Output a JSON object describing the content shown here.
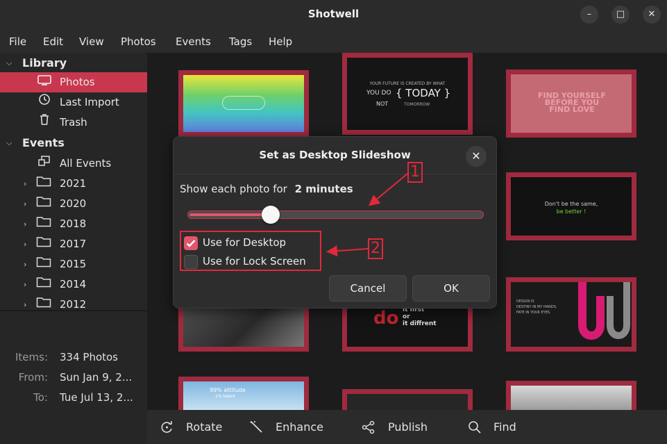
{
  "window": {
    "title": "Shotwell"
  },
  "window_controls": {
    "minimize": "–",
    "maximize": "□",
    "close": "✕"
  },
  "menu": [
    "File",
    "Edit",
    "View",
    "Photos",
    "Events",
    "Tags",
    "Help"
  ],
  "sidebar": {
    "library_header": "Library",
    "library_items": [
      {
        "label": "Photos",
        "icon": "monitor-icon",
        "selected": true
      },
      {
        "label": "Last Import",
        "icon": "history-icon"
      },
      {
        "label": "Trash",
        "icon": "trash-icon"
      }
    ],
    "events_header": "Events",
    "all_events": "All Events",
    "years": [
      "2021",
      "2020",
      "2018",
      "2017",
      "2015",
      "2014",
      "2012"
    ]
  },
  "info": {
    "items_label": "Items:",
    "items_value": "334 Photos",
    "from_label": "From:",
    "from_value": "Sun Jan 9, 2...",
    "to_label": "To:",
    "to_value": "Tue Jul 13, 2..."
  },
  "thumbnails": {
    "t2_lines": [
      "YOUR FUTURE IS CREATED BY WHAT",
      "YOU DO",
      "{ TODAY }",
      "NOT",
      "TOMORROW"
    ],
    "t3_lines": [
      "FIND YOURSELF",
      "BEFORE YOU",
      "FIND LOVE"
    ],
    "t6_lines": [
      "Don't be the same,",
      "be better !"
    ],
    "t8_lines": [
      "do",
      "it first",
      "or",
      "it diffrent"
    ],
    "t9_lines": [
      "DESIGN IS",
      "DESTINY IN MY HANDS,",
      "FATE IN YOUR EYES."
    ],
    "t10_lines": [
      "99% attitude",
      "1% talent"
    ]
  },
  "toolbar": {
    "rotate": "Rotate",
    "enhance": "Enhance",
    "publish": "Publish",
    "find": "Find"
  },
  "dialog": {
    "title": "Set as Desktop Slideshow",
    "show_label": "Show each photo for",
    "duration": "2 minutes",
    "slider_fraction": 0.28,
    "use_desktop": "Use for Desktop",
    "use_desktop_checked": true,
    "use_lock": "Use for Lock Screen",
    "use_lock_checked": false,
    "cancel": "Cancel",
    "ok": "OK"
  },
  "annotations": {
    "callout_1": "1",
    "callout_2": "2"
  },
  "colors": {
    "accent": "#c8374e",
    "thumb_border": "#a02a3f",
    "annotation": "#e2283a"
  }
}
